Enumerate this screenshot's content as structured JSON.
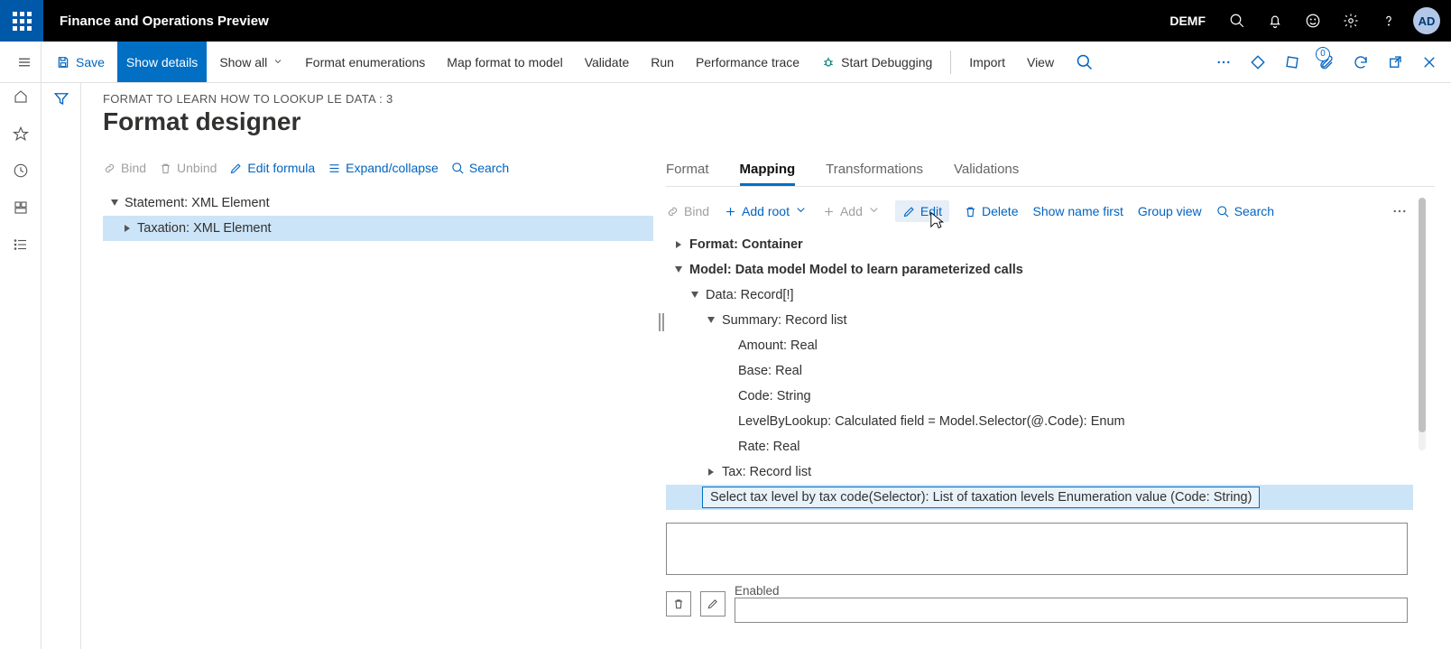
{
  "app": {
    "title": "Finance and Operations Preview",
    "company": "DEMF",
    "avatar": "AD",
    "badge0": "0"
  },
  "commandbar": {
    "save": "Save",
    "show_details": "Show details",
    "show_all": "Show all",
    "format_enum": "Format enumerations",
    "map_format": "Map format to model",
    "validate": "Validate",
    "run": "Run",
    "perf_trace": "Performance trace",
    "start_debug": "Start Debugging",
    "import": "Import",
    "view": "View"
  },
  "page": {
    "crumb": "FORMAT TO LEARN HOW TO LOOKUP LE DATA : 3",
    "title": "Format designer"
  },
  "left_toolbar": {
    "bind": "Bind",
    "unbind": "Unbind",
    "edit_formula": "Edit formula",
    "expand": "Expand/collapse",
    "search": "Search"
  },
  "left_tree": {
    "n0": "Statement: XML Element",
    "n1": "Taxation: XML Element"
  },
  "right_tabs": {
    "format": "Format",
    "mapping": "Mapping",
    "transformations": "Transformations",
    "validations": "Validations"
  },
  "right_toolbar": {
    "bind": "Bind",
    "add_root": "Add root",
    "add": "Add",
    "edit": "Edit",
    "delete": "Delete",
    "show_name_first": "Show name first",
    "group_view": "Group view",
    "search": "Search"
  },
  "right_tree": {
    "r0": "Format: Container",
    "r1": "Model: Data model Model to learn parameterized calls",
    "r2": "Data: Record[!]",
    "r3": "Summary: Record list",
    "r4": "Amount: Real",
    "r5": "Base: Real",
    "r6": "Code: String",
    "r7": "LevelByLookup: Calculated field = Model.Selector(@.Code): Enum",
    "r8": "Rate: Real",
    "r9": "Tax: Record list",
    "r10": "Select tax level by tax code(Selector): List of taxation levels Enumeration value (Code: String)"
  },
  "bottom": {
    "enabled": "Enabled"
  }
}
